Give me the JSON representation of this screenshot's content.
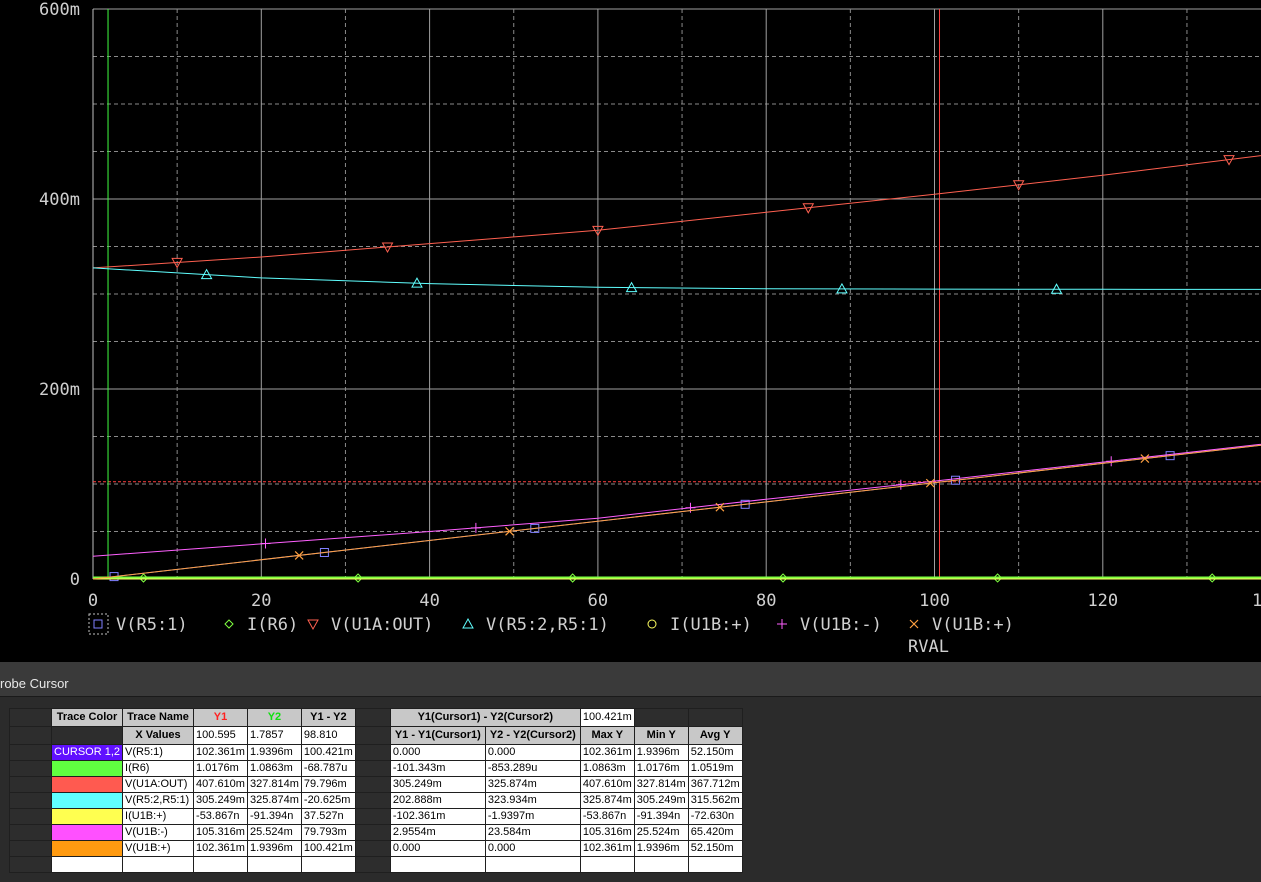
{
  "chart_data": {
    "type": "line",
    "xlabel": "RVAL",
    "x_ticks": [
      "0",
      "20",
      "40",
      "60",
      "80",
      "100",
      "120",
      "1"
    ],
    "y_ticks": [
      "0",
      "200m",
      "400m",
      "600m"
    ],
    "xlim": [
      0,
      140
    ],
    "ylim": [
      0,
      600
    ],
    "y_unit": "m",
    "grid": true,
    "cursors": {
      "cursor1": {
        "x": 100.595,
        "y": 102.361,
        "color": "#ff4040"
      },
      "cursor2": {
        "x": 1.7857,
        "y": 1.9396,
        "color": "#40ff40"
      }
    },
    "series": [
      {
        "name": "V(R5:1)",
        "color": "#8080ff",
        "marker": "square",
        "x": [
          0,
          140
        ],
        "y": [
          0,
          142
        ]
      },
      {
        "name": "I(R6)",
        "color": "#80ff40",
        "marker": "diamond",
        "x": [
          0,
          140
        ],
        "y": [
          1.02,
          1.09
        ]
      },
      {
        "name": "V(U1A:OUT)",
        "color": "#ff6050",
        "marker": "tri-down",
        "x": [
          0,
          20,
          40,
          60,
          80,
          100,
          120,
          140
        ],
        "y": [
          327.5,
          339,
          353,
          367,
          386,
          405,
          425,
          447
        ]
      },
      {
        "name": "V(R5:2,R5:1)",
        "color": "#60ffff",
        "marker": "tri-up",
        "x": [
          0,
          20,
          40,
          60,
          80,
          100,
          120,
          140
        ],
        "y": [
          327.5,
          317,
          311,
          307,
          305.5,
          305.2,
          305,
          304.8
        ]
      },
      {
        "name": "I(U1B:+)",
        "color": "#ffff60",
        "marker": "circle",
        "x": [
          0,
          140
        ],
        "y": [
          0,
          0
        ]
      },
      {
        "name": "V(U1B:-)",
        "color": "#ff60ff",
        "marker": "plus",
        "x": [
          0,
          20,
          40,
          60,
          80,
          100,
          120,
          140
        ],
        "y": [
          24,
          37,
          50,
          64,
          84,
          103,
          123,
          143
        ]
      },
      {
        "name": "V(U1B:+)",
        "color": "#ffa040",
        "marker": "cross",
        "x": [
          0,
          140
        ],
        "y": [
          0,
          142
        ]
      }
    ]
  },
  "probe": {
    "title": "robe Cursor",
    "headers": {
      "trace_color": "Trace Color",
      "trace_name": "Trace Name",
      "y1": "Y1",
      "y2": "Y2",
      "y1_y2": "Y1 - Y2",
      "cursor_diff": "Y1(Cursor1) - Y2(Cursor2)",
      "cursor_diff_value": "100.421m",
      "x_values": "X Values",
      "x_y1": "100.595",
      "x_y2": "1.7857",
      "x_diff": "98.810",
      "y1_minus_y1c1": "Y1 - Y1(Cursor1)",
      "y2_minus_y2c2": "Y2 - Y2(Cursor2)",
      "max_y": "Max Y",
      "min_y": "Min Y",
      "avg_y": "Avg Y"
    },
    "rows": [
      {
        "swatch": "#6010ff",
        "swatch_label": "CURSOR 1,2",
        "name": "V(R5:1)",
        "y1": "102.361m",
        "y2": "1.9396m",
        "diff": "100.421m",
        "d1": "0.000",
        "d2": "0.000",
        "max": "102.361m",
        "min": "1.9396m",
        "avg": "52.150m"
      },
      {
        "swatch": "#60ff40",
        "swatch_label": "",
        "name": "I(R6)",
        "y1": "1.0176m",
        "y2": "1.0863m",
        "diff": "-68.787u",
        "d1": "-101.343m",
        "d2": "-853.289u",
        "max": "1.0863m",
        "min": "1.0176m",
        "avg": "1.0519m"
      },
      {
        "swatch": "#ff5a50",
        "swatch_label": "",
        "name": "V(U1A:OUT)",
        "y1": "407.610m",
        "y2": "327.814m",
        "diff": "79.796m",
        "d1": "305.249m",
        "d2": "325.874m",
        "max": "407.610m",
        "min": "327.814m",
        "avg": "367.712m"
      },
      {
        "swatch": "#60ffff",
        "swatch_label": "",
        "name": "V(R5:2,R5:1)",
        "y1": "305.249m",
        "y2": "325.874m",
        "diff": "-20.625m",
        "d1": "202.888m",
        "d2": "323.934m",
        "max": "325.874m",
        "min": "305.249m",
        "avg": "315.562m"
      },
      {
        "swatch": "#ffff50",
        "swatch_label": "",
        "name": "I(U1B:+)",
        "y1": "-53.867n",
        "y2": "-91.394n",
        "diff": "37.527n",
        "d1": "-102.361m",
        "d2": "-1.9397m",
        "max": "-53.867n",
        "min": "-91.394n",
        "avg": "-72.630n"
      },
      {
        "swatch": "#ff50ff",
        "swatch_label": "",
        "name": "V(U1B:-)",
        "y1": "105.316m",
        "y2": "25.524m",
        "diff": "79.793m",
        "d1": "2.9554m",
        "d2": "23.584m",
        "max": "105.316m",
        "min": "25.524m",
        "avg": "65.420m"
      },
      {
        "swatch": "#ff9a10",
        "swatch_label": "",
        "name": "V(U1B:+)",
        "y1": "102.361m",
        "y2": "1.9396m",
        "diff": "100.421m",
        "d1": "0.000",
        "d2": "0.000",
        "max": "102.361m",
        "min": "1.9396m",
        "avg": "52.150m"
      },
      {
        "swatch": "#ffffff",
        "swatch_label": "",
        "name": "",
        "y1": "",
        "y2": "",
        "diff": "",
        "d1": "",
        "d2": "",
        "max": "",
        "min": "",
        "avg": ""
      }
    ]
  }
}
